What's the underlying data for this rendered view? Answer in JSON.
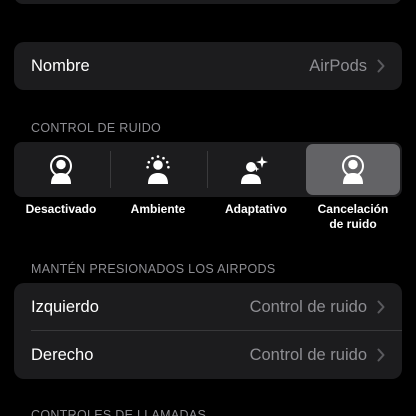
{
  "name_row": {
    "label": "Nombre",
    "value": "AirPods"
  },
  "noise_control": {
    "header": "CONTROL DE RUIDO",
    "options": [
      {
        "label": "Desactivado",
        "icon": "person-off-icon",
        "selected": false
      },
      {
        "label": "Ambiente",
        "icon": "person-transparency-icon",
        "selected": false
      },
      {
        "label": "Adaptativo",
        "icon": "person-adaptive-icon",
        "selected": false
      },
      {
        "label_line1": "Cancelación",
        "label_line2": "de ruido",
        "icon": "person-noise-cancel-icon",
        "selected": true
      }
    ]
  },
  "press_hold": {
    "header": "MANTÉN PRESIONADOS LOS AIRPODS",
    "rows": [
      {
        "label": "Izquierdo",
        "value": "Control de ruido"
      },
      {
        "label": "Derecho",
        "value": "Control de ruido"
      }
    ]
  },
  "calls": {
    "header": "CONTROLES DE LLAMADAS"
  },
  "colors": {
    "background": "#000000",
    "card": "#1c1c1e",
    "selected_segment": "#636366",
    "secondary_text": "#8e8e93",
    "separator": "#38383a"
  }
}
